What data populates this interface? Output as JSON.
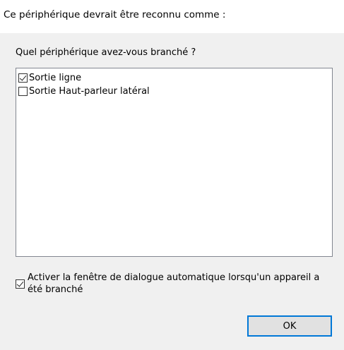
{
  "header": {
    "title": "Ce périphérique devrait être reconnu comme :"
  },
  "device_selection": {
    "question": "Quel périphérique avez-vous branché ?",
    "items": [
      {
        "label": "Sortie ligne",
        "checked": true
      },
      {
        "label": "Sortie Haut-parleur latéral",
        "checked": false
      }
    ]
  },
  "auto_dialog": {
    "label": "Activer la fenêtre de dialogue automatique lorsqu'un appareil a été branché",
    "checked": true
  },
  "buttons": {
    "ok_label": "OK"
  },
  "colors": {
    "panel_background": "#f0f0f0",
    "button_focus_border": "#0078d7"
  }
}
